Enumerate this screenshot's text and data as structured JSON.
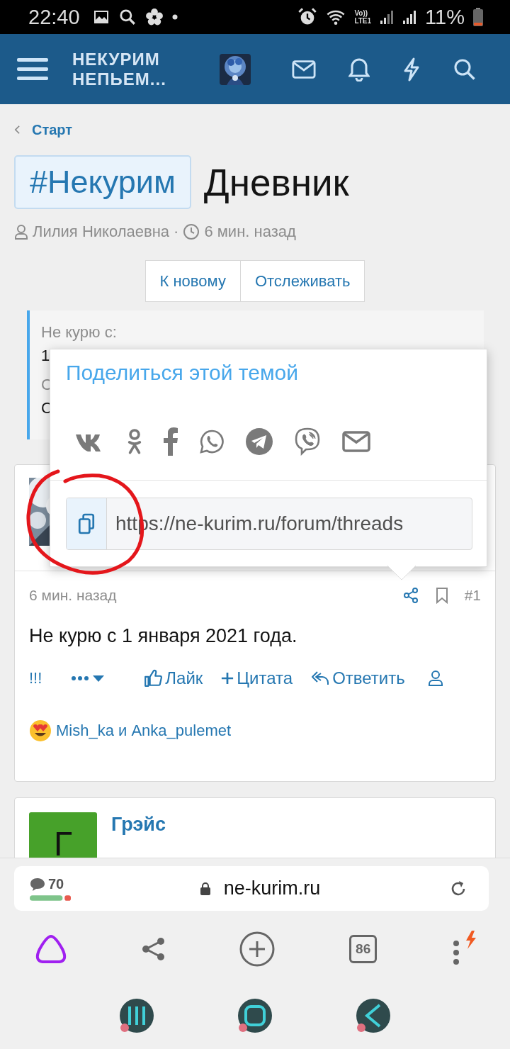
{
  "status_bar": {
    "time": "22:40",
    "volte": "Vo))",
    "lte": "LTE1",
    "battery": "11%"
  },
  "header": {
    "logo_lines": [
      "НЕКУРИМ",
      "НЕПЬЕМ..."
    ]
  },
  "breadcrumb": "Старт",
  "title": {
    "tag": "#Некурим",
    "text": "Дневник"
  },
  "meta": {
    "author": "Лилия Николаевна",
    "separator": "·",
    "time": "6 мин. назад"
  },
  "buttons": [
    "К новому",
    "Отслеживать"
  ],
  "field_block": [
    {
      "kind": "label",
      "text": "Не курю с:"
    },
    {
      "kind": "value",
      "text": "1"
    },
    {
      "kind": "label",
      "text": "С"
    },
    {
      "kind": "value",
      "text": "С"
    }
  ],
  "share_popup": {
    "title": "Поделиться этой темой",
    "services": [
      {
        "kind": "vk"
      },
      {
        "kind": "ok"
      },
      {
        "kind": "facebook"
      },
      {
        "kind": "whatsapp"
      },
      {
        "kind": "telegram"
      },
      {
        "kind": "viber"
      },
      {
        "kind": "email"
      }
    ],
    "url": "https://ne-kurim.ru/forum/threads"
  },
  "post": {
    "time": "6 мин. назад",
    "number": "#1",
    "text": "Не курю с 1 января 2021 года.",
    "actions": [
      {
        "kind": "text",
        "label": "!!!"
      },
      {
        "kind": "more"
      },
      {
        "kind": "like",
        "label": "Лайк"
      },
      {
        "kind": "quote",
        "label": "Цитата"
      },
      {
        "kind": "reply",
        "label": "Ответить"
      },
      {
        "kind": "user"
      }
    ],
    "reactions": "Mish_ka и Anka_pulemet"
  },
  "next_post": {
    "author": "Грэйс",
    "avatar_letter": "Г"
  },
  "browser": {
    "comments": "70",
    "url": "ne-kurim.ru",
    "tabs": "86"
  }
}
